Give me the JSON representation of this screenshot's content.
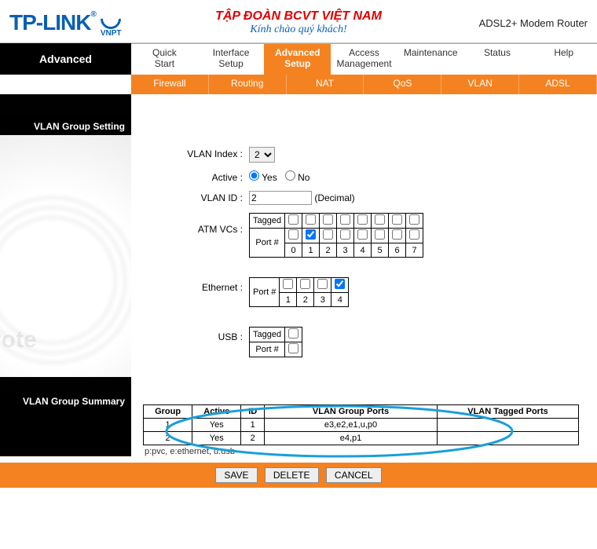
{
  "header": {
    "logo_text": "TP-LINK",
    "vnpt_label": "VNPT",
    "title_line1": "TẬP ĐOÀN BCVT VIỆT NAM",
    "title_line2": "Kính chào quý khách!",
    "product": "ADSL2+ Modem Router"
  },
  "nav": {
    "left_label": "Advanced",
    "tabs": [
      {
        "l1": "Quick",
        "l2": "Start"
      },
      {
        "l1": "Interface",
        "l2": "Setup"
      },
      {
        "l1": "Advanced",
        "l2": "Setup"
      },
      {
        "l1": "Access",
        "l2": "Management"
      },
      {
        "l1": "Maintenance",
        "l2": ""
      },
      {
        "l1": "Status",
        "l2": ""
      },
      {
        "l1": "Help",
        "l2": ""
      }
    ],
    "active_tab_index": 2,
    "subtabs": [
      "Firewall",
      "Routing",
      "NAT",
      "QoS",
      "VLAN",
      "ADSL"
    ]
  },
  "section1": {
    "title": "VLAN Group Setting"
  },
  "form": {
    "vlan_index_label": "VLAN Index :",
    "vlan_index_value": "2",
    "active_label": "Active :",
    "active_yes": "Yes",
    "active_no": "No",
    "vlan_id_label": "VLAN ID :",
    "vlan_id_value": "2",
    "vlan_id_hint": "(Decimal)",
    "atm_vcs_label": "ATM VCs :",
    "ethernet_label": "Ethernet :",
    "usb_label": "USB :",
    "tagged_lbl": "Tagged",
    "port_lbl": "Port #",
    "atm_ports": [
      "0",
      "1",
      "2",
      "3",
      "4",
      "5",
      "6",
      "7"
    ],
    "atm_port_checked_index": 1,
    "eth_ports": [
      "1",
      "2",
      "3",
      "4"
    ],
    "eth_port_checked_index": 3
  },
  "section2": {
    "title": "VLAN Group Summary",
    "headers": [
      "Group",
      "Active",
      "ID",
      "VLAN Group Ports",
      "VLAN Tagged Ports"
    ],
    "rows": [
      {
        "group": "1",
        "active": "Yes",
        "id": "1",
        "ports": "e3,e2,e1,u,p0",
        "tagged": ""
      },
      {
        "group": "2",
        "active": "Yes",
        "id": "2",
        "ports": "e4,p1",
        "tagged": ""
      }
    ],
    "legend": "p:pvc, e:ethernet, u:usb"
  },
  "buttons": {
    "save": "SAVE",
    "delete": "DELETE",
    "cancel": "CANCEL"
  },
  "watermark": "Prote"
}
